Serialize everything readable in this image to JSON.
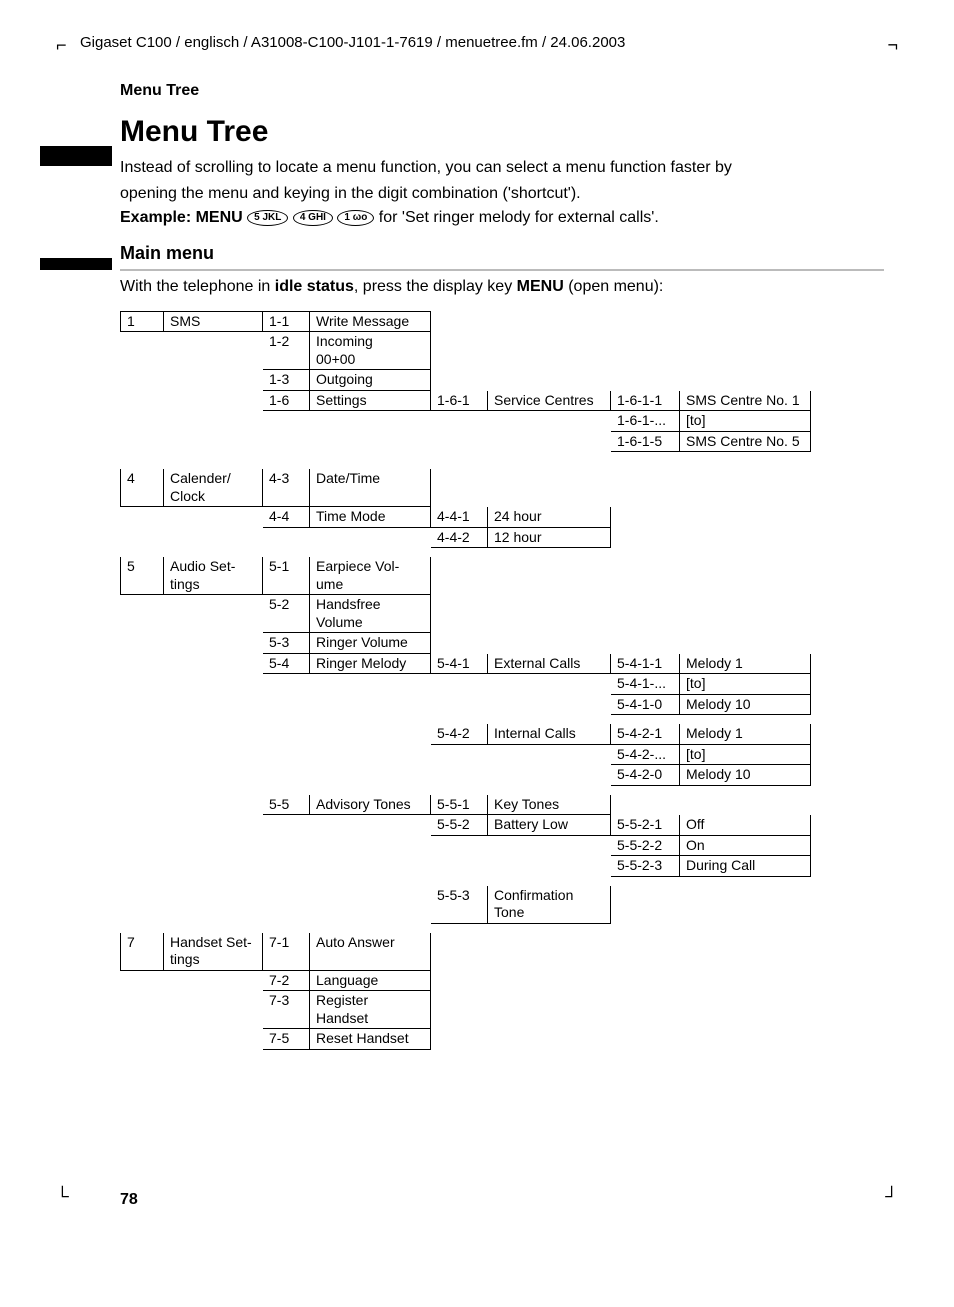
{
  "header": "Gigaset C100 / englisch / A31008-C100-J101-1-7619 / menuetree.fm / 24.06.2003",
  "section_label": "Menu Tree",
  "title": "Menu Tree",
  "intro1": "Instead of scrolling to locate a menu function, you can select a menu function faster by",
  "intro2": "opening the menu and keying in the digit combination ('shortcut').",
  "example_prefix": "Example: MENU",
  "key1": "5 JKL",
  "key2": "4 GHI",
  "key3": "1 ωο",
  "example_suffix": " for 'Set ringer melody for external calls'.",
  "subhead": "Main menu",
  "idle_a": "With the telephone in  ",
  "idle_b": "idle status",
  "idle_c": ", press the display key ",
  "idle_d": "MENU",
  "idle_e": " (open menu):",
  "page_num": "78",
  "r1": {
    "a": "1",
    "b": "SMS",
    "c": "1-1",
    "d": "Write Message"
  },
  "r2": {
    "c": "1-2",
    "d": "Incoming\n00+00"
  },
  "r3": {
    "c": "1-3",
    "d": "Outgoing"
  },
  "r4": {
    "c": "1-6",
    "d": "Settings",
    "e": "1-6-1",
    "f": "Service Centres",
    "g": "1-6-1-1",
    "h": "SMS Centre No. 1"
  },
  "r4b": {
    "g": "1-6-1-...",
    "h": "[to]"
  },
  "r4c": {
    "g": "1-6-1-5",
    "h": "SMS Centre No. 5"
  },
  "r5": {
    "a": "4",
    "b": "Calender/\nClock",
    "c": "4-3",
    "d": "Date/Time"
  },
  "r6": {
    "c": "4-4",
    "d": "Time Mode",
    "e": "4-4-1",
    "f": "24 hour"
  },
  "r6b": {
    "e": "4-4-2",
    "f": "12 hour"
  },
  "r7": {
    "a": "5",
    "b": "Audio Set-\ntings",
    "c": "5-1",
    "d": "Earpiece Vol-\nume"
  },
  "r8": {
    "c": "5-2",
    "d": "Handsfree\nVolume"
  },
  "r9": {
    "c": "5-3",
    "d": "Ringer Volume"
  },
  "r10": {
    "c": "5-4",
    "d": "Ringer Melody",
    "e": "5-4-1",
    "f": "External Calls",
    "g": "5-4-1-1",
    "h": "Melody 1"
  },
  "r10b": {
    "g": "5-4-1-...",
    "h": "[to]"
  },
  "r10c": {
    "g": "5-4-1-0",
    "h": "Melody 10"
  },
  "r11": {
    "e": "5-4-2",
    "f": "Internal Calls",
    "g": "5-4-2-1",
    "h": "Melody 1"
  },
  "r11b": {
    "g": "5-4-2-...",
    "h": "[to]"
  },
  "r11c": {
    "g": "5-4-2-0",
    "h": "Melody 10"
  },
  "r12": {
    "c": "5-5",
    "d": "Advisory Tones",
    "e": "5-5-1",
    "f": "Key Tones"
  },
  "r13": {
    "e": "5-5-2",
    "f": "Battery Low",
    "g": "5-5-2-1",
    "h": "Off"
  },
  "r13b": {
    "g": "5-5-2-2",
    "h": "On"
  },
  "r13c": {
    "g": "5-5-2-3",
    "h": "During Call"
  },
  "r14": {
    "e": "5-5-3",
    "f": "Confirmation\nTone"
  },
  "r15": {
    "a": "7",
    "b": "Handset Set-\ntings",
    "c": "7-1",
    "d": "Auto Answer"
  },
  "r16": {
    "c": "7-2",
    "d": "Language"
  },
  "r17": {
    "c": "7-3",
    "d": "Register\nHandset"
  },
  "r18": {
    "c": "7-5",
    "d": "Reset Handset"
  }
}
